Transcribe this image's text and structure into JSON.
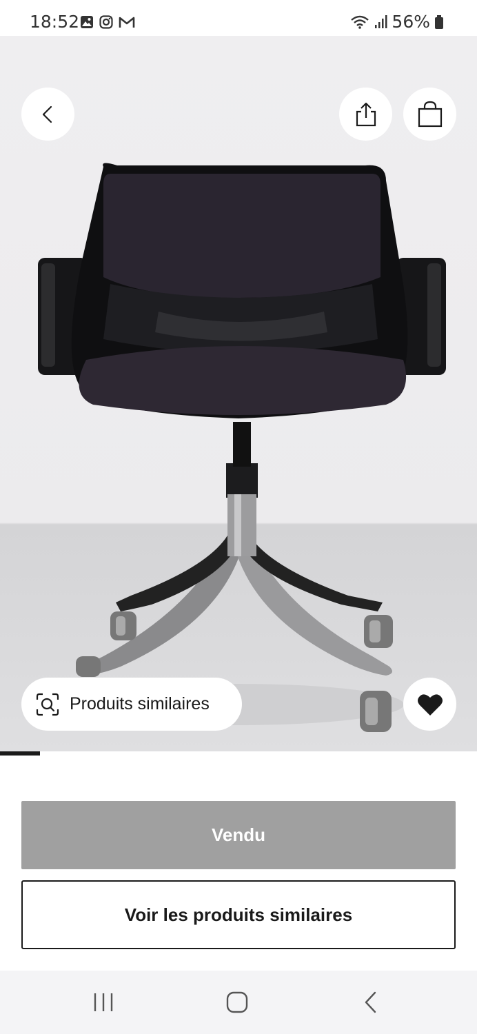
{
  "status_bar": {
    "time": "18:52",
    "battery": "56%",
    "left_icons": [
      "gallery-icon",
      "instagram-icon",
      "gmail-icon"
    ],
    "right_icons": [
      "wifi-icon",
      "signal-icon",
      "battery-icon"
    ]
  },
  "product": {
    "gallery": {
      "image": "black-swivel-office-chair-photo",
      "current_index": 1,
      "progress": 0.084
    },
    "similar_pill_label": "Produits similaires",
    "favorite": {
      "active": true
    }
  },
  "actions": {
    "sold_label": "Vendu",
    "similar_button_label": "Voir les produits similaires"
  },
  "colors": {
    "sold_button_bg": "#a0a0a0",
    "text": "#1a1a1a",
    "hero_bg": "#efeef0"
  },
  "nav": {
    "items": [
      "recents-icon",
      "home-icon",
      "back-icon"
    ]
  }
}
